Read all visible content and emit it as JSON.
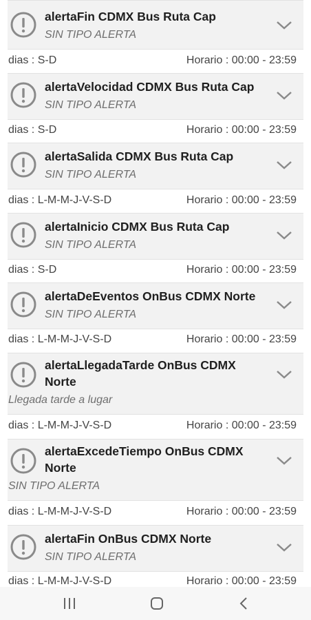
{
  "alerts": [
    {
      "title": "alertaFin CDMX Bus Ruta Cap",
      "subtitle": "SIN TIPO ALERTA",
      "days": "dias : S-D",
      "hours": "Horario : 00:00 - 23:59"
    },
    {
      "title": "alertaVelocidad CDMX Bus Ruta Cap",
      "subtitle": "SIN TIPO ALERTA",
      "days": "dias : S-D",
      "hours": "Horario : 00:00 - 23:59"
    },
    {
      "title": "alertaSalida CDMX Bus Ruta Cap",
      "subtitle": "SIN TIPO ALERTA",
      "days": "dias : L-M-M-J-V-S-D",
      "hours": "Horario : 00:00 - 23:59"
    },
    {
      "title": "alertaInicio CDMX Bus Ruta Cap",
      "subtitle": "SIN TIPO ALERTA",
      "days": "dias : S-D",
      "hours": "Horario : 00:00 - 23:59"
    },
    {
      "title": "alertaDeEventos OnBus CDMX Norte",
      "subtitle": "SIN TIPO ALERTA",
      "days": "dias : L-M-M-J-V-S-D",
      "hours": "Horario : 00:00 - 23:59"
    },
    {
      "title": "alertaLlegadaTarde OnBus CDMX Norte",
      "subtitle": "Llegada tarde a lugar",
      "days": "dias : L-M-M-J-V-S-D",
      "hours": "Horario : 00:00 - 23:59"
    },
    {
      "title": "alertaExcedeTiempo OnBus CDMX Norte",
      "subtitle": "SIN TIPO ALERTA",
      "days": "dias : L-M-M-J-V-S-D",
      "hours": "Horario : 00:00 - 23:59"
    },
    {
      "title": "alertaFin OnBus CDMX Norte",
      "subtitle": "SIN TIPO ALERTA",
      "days": "dias : L-M-M-J-V-S-D",
      "hours": "Horario : 00:00 - 23:59"
    }
  ],
  "icons": {
    "alert": "exclamation-circle-icon",
    "expand": "chevron-down-icon",
    "nav_recents": "recent-apps-icon",
    "nav_home": "home-icon",
    "nav_back": "back-icon"
  },
  "colors": {
    "card_bg": "#f2f2f2",
    "icon_gray": "#8a8a8a"
  }
}
